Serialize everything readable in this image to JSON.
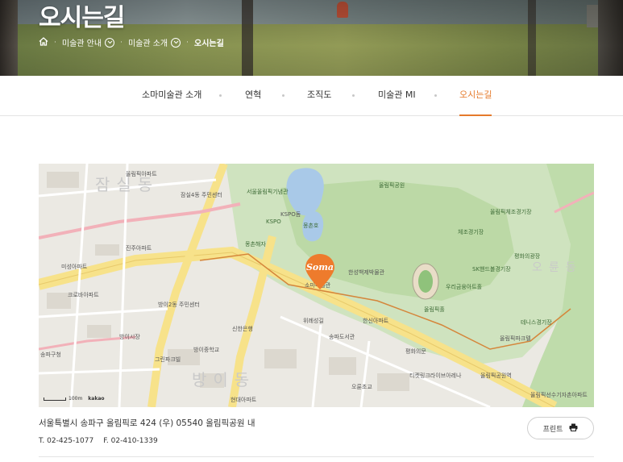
{
  "hero": {
    "title": "오시는길",
    "breadcrumb": [
      {
        "label": "미술관 안내",
        "dropdown": true
      },
      {
        "label": "미술관 소개",
        "dropdown": true
      },
      {
        "label": "오시는길",
        "dropdown": false
      }
    ]
  },
  "subnav": {
    "items": [
      "소마미술관 소개",
      "연혁",
      "조직도",
      "미술관 MI",
      "오시는길"
    ],
    "active": "오시는길"
  },
  "map": {
    "marker_label": "Soma",
    "scale_label": "100m",
    "provider": "kakao",
    "labels": {
      "district_jamsil": "잠실동",
      "district_bangi": "방이동",
      "district_oryun": "오륜동",
      "olympic_park": "올림픽공원",
      "seoul_olympic_monument": "서울올림픽기념관",
      "mongchon_lake": "몽촌호",
      "monchon_haeja": "몽촌해자",
      "kspo": "KSPO",
      "handball": "SK핸드볼경기장",
      "woori_hall": "우리금융아트홀",
      "peace_square": "평화의광장",
      "olympic_hall": "올림픽홀",
      "tennis": "테니스경기장",
      "ticket_link": "티켓링크라이브아레나",
      "olympic_parktel": "올림픽파크텔",
      "sports_center": "KSPO돔",
      "jamsil_station": "잠실4동 주민센터",
      "bangi_station": "방이2동 주민센터",
      "songpa_station": "송파구청",
      "olympic_apt": "올림픽아파트",
      "jinju_apt": "진주아파트",
      "mijin_apt": "미성아파트",
      "crown_apt": "크로바아파트",
      "hanshin_apt": "한신아파트",
      "olympic_jihak": "올림픽체조경기장",
      "sinhan_bank": "신한은행",
      "soma_museum": "소마미술관",
      "hanseong": "한성백제박물관",
      "bangi_school": "방이중학교",
      "oryun_school": "오륜초교",
      "healthcare": "위례성길",
      "gimnasia": "체조경기장",
      "songpa_library": "송파도서관",
      "moon_gate": "평화의문",
      "olympic_station": "올림픽공원역",
      "bangi_market": "방이시장",
      "green_park": "그린파크빌",
      "hyundai": "현대아파트",
      "oryun_apt": "올림픽선수기자촌아파트"
    }
  },
  "contact": {
    "address": "서울특별시 송파구 올림픽로 424 (우) 05540 올림픽공원 내",
    "tel": "T. 02-425-1077",
    "fax": "F. 02-410-1339",
    "print_label": "프린트"
  },
  "colors": {
    "accent": "#e57a2b",
    "park_green": "#c8e0b4",
    "water": "#a9c9e8",
    "road_yellow": "#f7e28a",
    "road_pink": "#f2b1b9",
    "marker": "#ee7b2c"
  }
}
